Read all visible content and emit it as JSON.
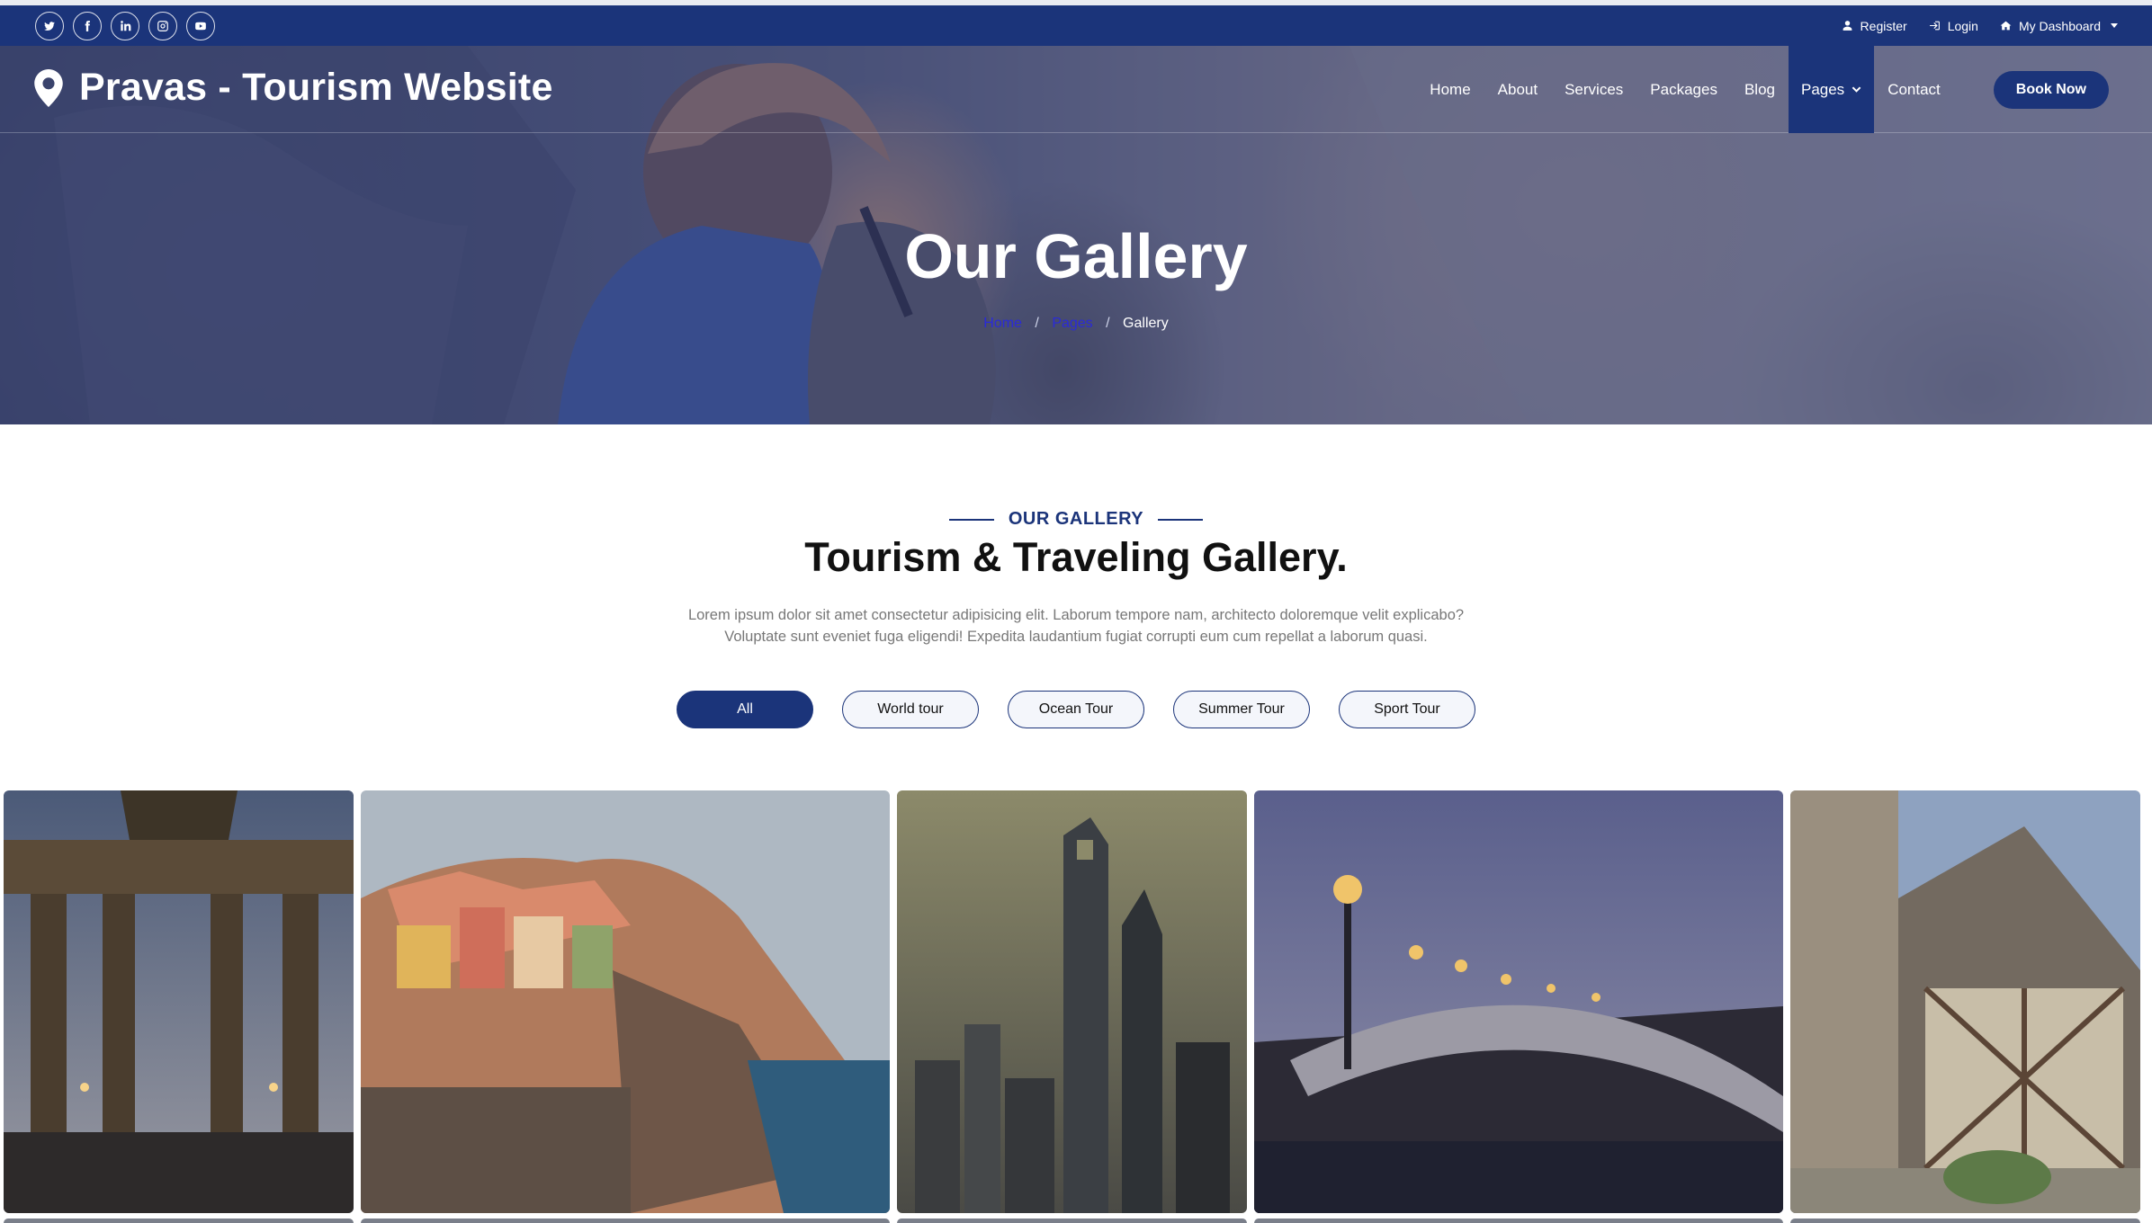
{
  "topbar": {
    "social": [
      {
        "icon": "twitter-icon"
      },
      {
        "icon": "facebook-icon"
      },
      {
        "icon": "linkedin-icon"
      },
      {
        "icon": "instagram-icon"
      },
      {
        "icon": "youtube-icon"
      }
    ],
    "links": {
      "register": "Register",
      "login": "Login",
      "dashboard": "My Dashboard"
    }
  },
  "brand": {
    "name": "Pravas - Tourism Website",
    "icon": "map-marker-icon"
  },
  "nav": {
    "items": [
      "Home",
      "About",
      "Services",
      "Packages",
      "Blog",
      "Pages",
      "Contact"
    ],
    "active": "Pages",
    "cta": "Book Now"
  },
  "hero": {
    "title": "Our Gallery",
    "breadcrumb": [
      "Home",
      "Pages",
      "Gallery"
    ]
  },
  "section": {
    "eyebrow": "OUR GALLERY",
    "title": "Tourism & Traveling Gallery.",
    "description_line1": "Lorem ipsum dolor sit amet consectetur adipisicing elit. Laborum tempore nam, architecto doloremque velit explicabo?",
    "description_line2": "Voluptate sunt eveniet fuga eligendi! Expedita laudantium fugiat corrupti eum cum repellat a laborum quasi."
  },
  "filters": {
    "items": [
      "All",
      "World tour",
      "Ocean Tour",
      "Summer Tour",
      "Sport Tour"
    ],
    "active": "All"
  },
  "gallery": {
    "images": [
      {
        "subject": "brandenburg-gate"
      },
      {
        "subject": "cliffside-colorful-village"
      },
      {
        "subject": "city-skyscrapers"
      },
      {
        "subject": "bridge-with-lamps-at-dusk"
      },
      {
        "subject": "half-timbered-house"
      }
    ]
  },
  "colors": {
    "primary": "#1b347a",
    "link": "#2a2ad8",
    "white": "#ffffff"
  }
}
